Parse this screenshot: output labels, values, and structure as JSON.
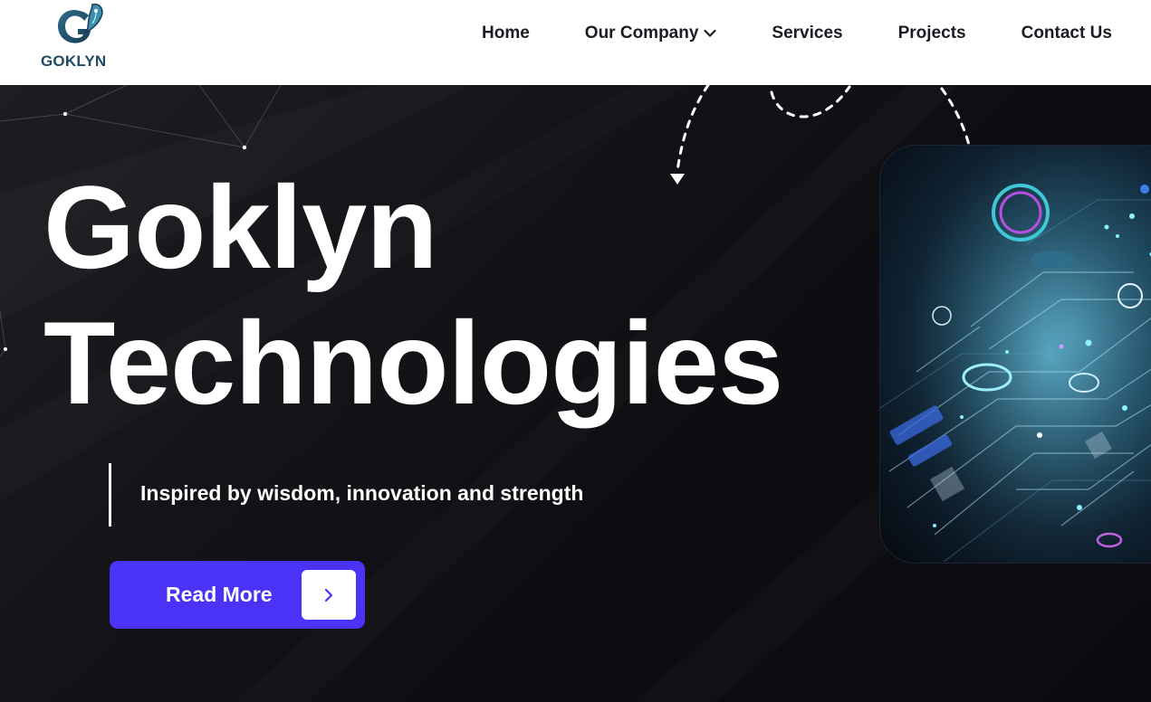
{
  "brand": {
    "name": "GOKLYN",
    "accent": "#4a32f6",
    "logo_color": "#1f4b63"
  },
  "nav": {
    "items": [
      {
        "label": "Home"
      },
      {
        "label": "Our Company",
        "has_dropdown": true
      },
      {
        "label": "Services"
      },
      {
        "label": "Projects"
      },
      {
        "label": "Contact Us"
      }
    ]
  },
  "hero": {
    "title_line1": "Goklyn",
    "title_line2": "Technologies",
    "tagline": "Inspired by wisdom, innovation and strength",
    "cta_label": "Read More",
    "cta_icon": "chevron-right-icon",
    "image_alt": "futuristic circuit board illustration"
  }
}
